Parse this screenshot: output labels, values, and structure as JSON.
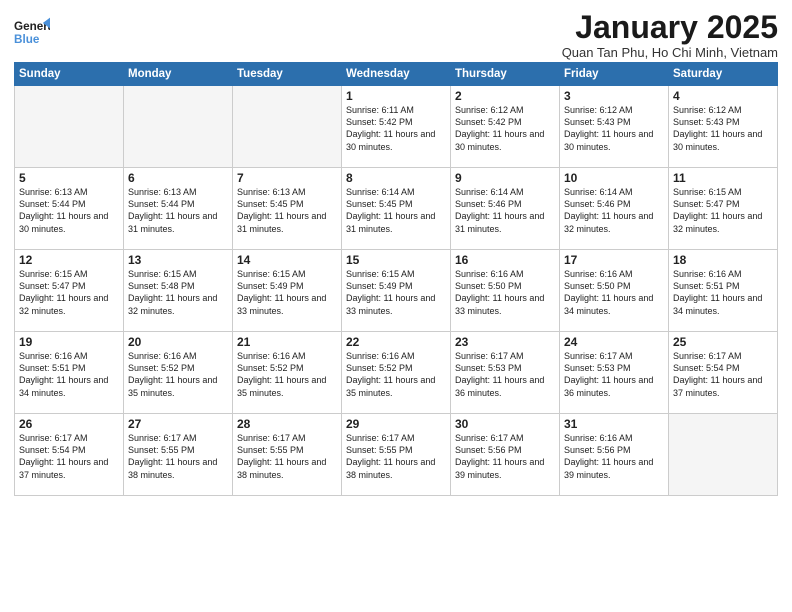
{
  "header": {
    "logo_line1": "General",
    "logo_line2": "Blue",
    "month": "January 2025",
    "location": "Quan Tan Phu, Ho Chi Minh, Vietnam"
  },
  "weekdays": [
    "Sunday",
    "Monday",
    "Tuesday",
    "Wednesday",
    "Thursday",
    "Friday",
    "Saturday"
  ],
  "weeks": [
    [
      {
        "day": "",
        "empty": true
      },
      {
        "day": "",
        "empty": true
      },
      {
        "day": "",
        "empty": true
      },
      {
        "day": "1",
        "sunrise": "6:11 AM",
        "sunset": "5:42 PM",
        "daylight": "11 hours and 30 minutes."
      },
      {
        "day": "2",
        "sunrise": "6:12 AM",
        "sunset": "5:42 PM",
        "daylight": "11 hours and 30 minutes."
      },
      {
        "day": "3",
        "sunrise": "6:12 AM",
        "sunset": "5:43 PM",
        "daylight": "11 hours and 30 minutes."
      },
      {
        "day": "4",
        "sunrise": "6:12 AM",
        "sunset": "5:43 PM",
        "daylight": "11 hours and 30 minutes."
      }
    ],
    [
      {
        "day": "5",
        "sunrise": "6:13 AM",
        "sunset": "5:44 PM",
        "daylight": "11 hours and 30 minutes."
      },
      {
        "day": "6",
        "sunrise": "6:13 AM",
        "sunset": "5:44 PM",
        "daylight": "11 hours and 31 minutes."
      },
      {
        "day": "7",
        "sunrise": "6:13 AM",
        "sunset": "5:45 PM",
        "daylight": "11 hours and 31 minutes."
      },
      {
        "day": "8",
        "sunrise": "6:14 AM",
        "sunset": "5:45 PM",
        "daylight": "11 hours and 31 minutes."
      },
      {
        "day": "9",
        "sunrise": "6:14 AM",
        "sunset": "5:46 PM",
        "daylight": "11 hours and 31 minutes."
      },
      {
        "day": "10",
        "sunrise": "6:14 AM",
        "sunset": "5:46 PM",
        "daylight": "11 hours and 32 minutes."
      },
      {
        "day": "11",
        "sunrise": "6:15 AM",
        "sunset": "5:47 PM",
        "daylight": "11 hours and 32 minutes."
      }
    ],
    [
      {
        "day": "12",
        "sunrise": "6:15 AM",
        "sunset": "5:47 PM",
        "daylight": "11 hours and 32 minutes."
      },
      {
        "day": "13",
        "sunrise": "6:15 AM",
        "sunset": "5:48 PM",
        "daylight": "11 hours and 32 minutes."
      },
      {
        "day": "14",
        "sunrise": "6:15 AM",
        "sunset": "5:49 PM",
        "daylight": "11 hours and 33 minutes."
      },
      {
        "day": "15",
        "sunrise": "6:15 AM",
        "sunset": "5:49 PM",
        "daylight": "11 hours and 33 minutes."
      },
      {
        "day": "16",
        "sunrise": "6:16 AM",
        "sunset": "5:50 PM",
        "daylight": "11 hours and 33 minutes."
      },
      {
        "day": "17",
        "sunrise": "6:16 AM",
        "sunset": "5:50 PM",
        "daylight": "11 hours and 34 minutes."
      },
      {
        "day": "18",
        "sunrise": "6:16 AM",
        "sunset": "5:51 PM",
        "daylight": "11 hours and 34 minutes."
      }
    ],
    [
      {
        "day": "19",
        "sunrise": "6:16 AM",
        "sunset": "5:51 PM",
        "daylight": "11 hours and 34 minutes."
      },
      {
        "day": "20",
        "sunrise": "6:16 AM",
        "sunset": "5:52 PM",
        "daylight": "11 hours and 35 minutes."
      },
      {
        "day": "21",
        "sunrise": "6:16 AM",
        "sunset": "5:52 PM",
        "daylight": "11 hours and 35 minutes."
      },
      {
        "day": "22",
        "sunrise": "6:16 AM",
        "sunset": "5:52 PM",
        "daylight": "11 hours and 35 minutes."
      },
      {
        "day": "23",
        "sunrise": "6:17 AM",
        "sunset": "5:53 PM",
        "daylight": "11 hours and 36 minutes."
      },
      {
        "day": "24",
        "sunrise": "6:17 AM",
        "sunset": "5:53 PM",
        "daylight": "11 hours and 36 minutes."
      },
      {
        "day": "25",
        "sunrise": "6:17 AM",
        "sunset": "5:54 PM",
        "daylight": "11 hours and 37 minutes."
      }
    ],
    [
      {
        "day": "26",
        "sunrise": "6:17 AM",
        "sunset": "5:54 PM",
        "daylight": "11 hours and 37 minutes."
      },
      {
        "day": "27",
        "sunrise": "6:17 AM",
        "sunset": "5:55 PM",
        "daylight": "11 hours and 38 minutes."
      },
      {
        "day": "28",
        "sunrise": "6:17 AM",
        "sunset": "5:55 PM",
        "daylight": "11 hours and 38 minutes."
      },
      {
        "day": "29",
        "sunrise": "6:17 AM",
        "sunset": "5:55 PM",
        "daylight": "11 hours and 38 minutes."
      },
      {
        "day": "30",
        "sunrise": "6:17 AM",
        "sunset": "5:56 PM",
        "daylight": "11 hours and 39 minutes."
      },
      {
        "day": "31",
        "sunrise": "6:16 AM",
        "sunset": "5:56 PM",
        "daylight": "11 hours and 39 minutes."
      },
      {
        "day": "",
        "empty": true
      }
    ]
  ]
}
